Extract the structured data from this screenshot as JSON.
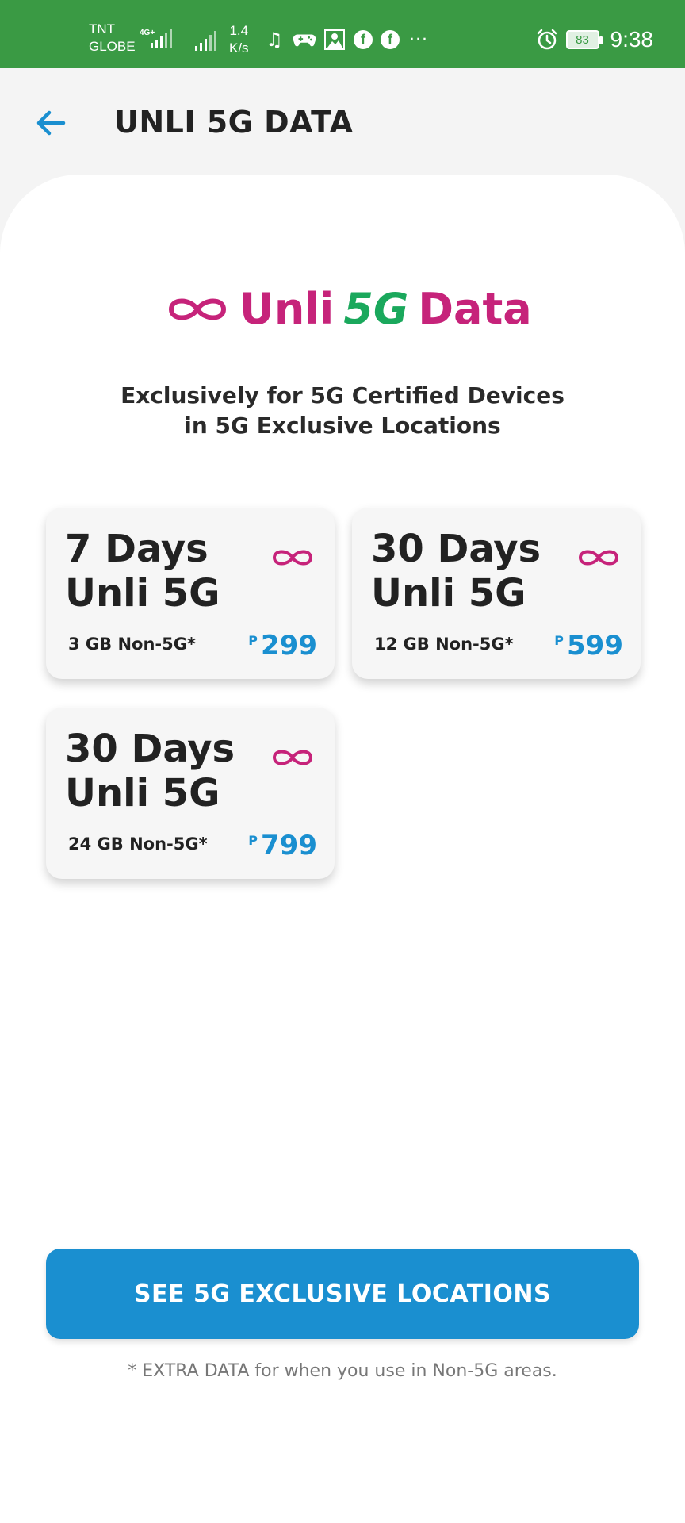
{
  "status_bar": {
    "carrier_line1": "TNT",
    "carrier_line2": "GLOBE",
    "network": "4G+",
    "speed_value": "1.4",
    "speed_unit": "K/s",
    "battery": "83",
    "time": "9:38",
    "background": "#3a9a44"
  },
  "header": {
    "title": "UNLI 5G DATA",
    "back_icon": "arrow-left-icon",
    "accent": "#1a8fd0"
  },
  "logo": {
    "text_prefix": "Unli",
    "text_5g": "5G",
    "text_suffix": "Data",
    "brand_color": "#c6237a",
    "accent_5g": "#1aa85c"
  },
  "subtitle": {
    "line1": "Exclusively for 5G Certified Devices",
    "line2": "in 5G Exclusive Locations"
  },
  "plans": [
    {
      "days": "7 Days",
      "name": "Unli 5G",
      "data": "3 GB Non-5G*",
      "currency": "P",
      "price": "299"
    },
    {
      "days": "30 Days",
      "name": "Unli 5G",
      "data": "12 GB Non-5G*",
      "currency": "P",
      "price": "599"
    },
    {
      "days": "30 Days",
      "name": "Unli 5G",
      "data": "24 GB Non-5G*",
      "currency": "P",
      "price": "799"
    }
  ],
  "cta": {
    "label": "SEE 5G EXCLUSIVE LOCATIONS"
  },
  "footnote": "* EXTRA DATA for when you use in Non-5G areas."
}
